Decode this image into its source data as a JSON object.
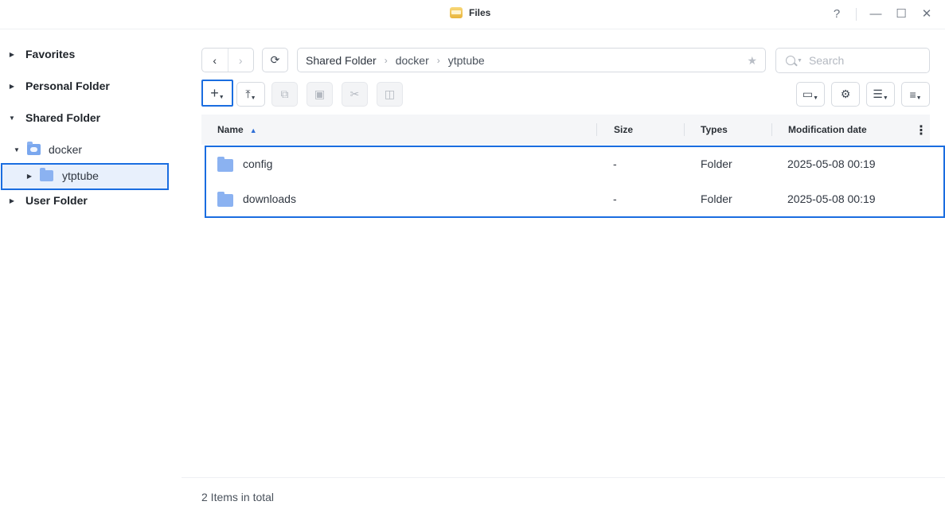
{
  "window": {
    "title": "Files",
    "help_icon": "?",
    "minimize_icon": "—",
    "maximize_icon": "☐",
    "close_icon": "✕"
  },
  "sidebar": {
    "items": [
      {
        "label": "Favorites",
        "expanded": false
      },
      {
        "label": "Personal Folder",
        "expanded": false
      },
      {
        "label": "Shared Folder",
        "expanded": true
      },
      {
        "label": "docker",
        "expanded": true
      },
      {
        "label": "ytptube",
        "expanded": false,
        "selected": true
      },
      {
        "label": "User Folder",
        "expanded": false
      }
    ]
  },
  "toolbar": {
    "back_icon": "‹",
    "forward_icon": "›",
    "refresh_icon": "⟳",
    "breadcrumb": [
      "Shared Folder",
      "docker",
      "ytptube"
    ],
    "favorite_icon": "★",
    "search_placeholder": "Search",
    "create_icon": "+",
    "upload_icon": "⤒",
    "copy_icon": "⧉",
    "paste_icon": "▣",
    "cut_icon": "✂",
    "rename_icon": "◫",
    "action_icon": "▭",
    "settings_icon": "⚙",
    "view_icon": "☰",
    "sort_icon": "≡"
  },
  "table": {
    "columns": [
      "Name",
      "Size",
      "Types",
      "Modification date"
    ],
    "sort_indicator": "▲",
    "more_icon": "⋮",
    "rows": [
      {
        "name": "config",
        "size": "-",
        "type": "Folder",
        "modified": "2025-05-08 00:19"
      },
      {
        "name": "downloads",
        "size": "-",
        "type": "Folder",
        "modified": "2025-05-08 00:19"
      }
    ]
  },
  "status": {
    "total": "2 Items in total"
  },
  "colors": {
    "accent": "#1a6de0",
    "folder": "#8bb2f1",
    "header_bg": "#f5f6f8"
  }
}
